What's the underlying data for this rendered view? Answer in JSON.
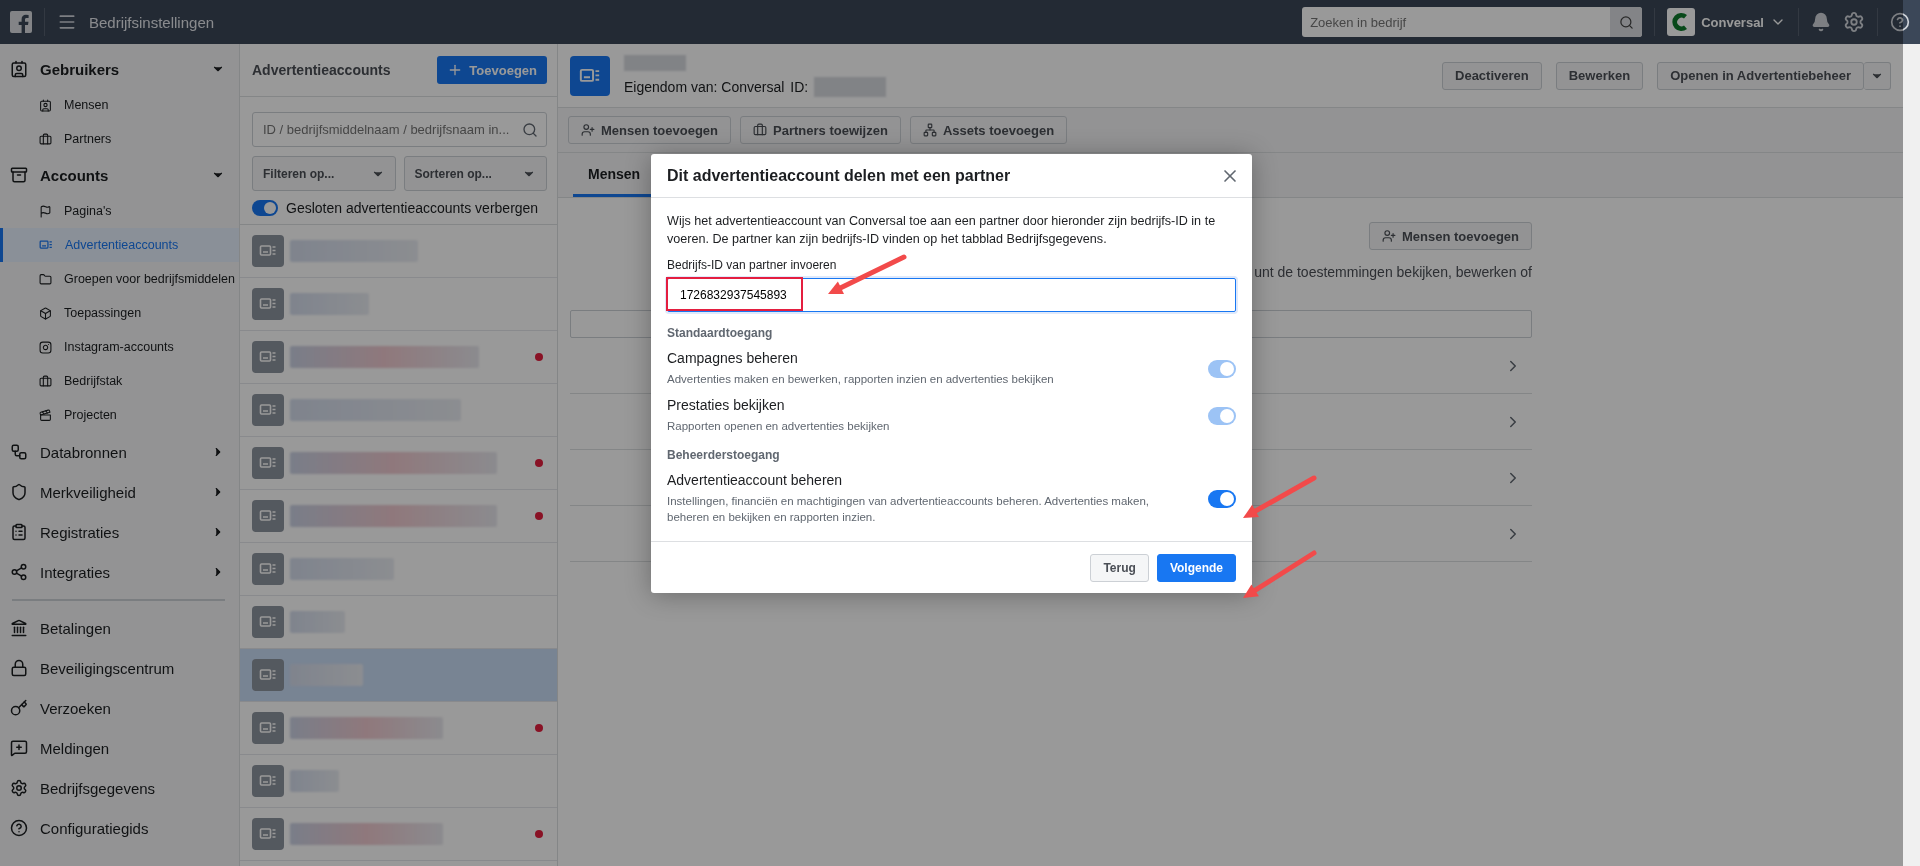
{
  "top_bar": {
    "title": "Bedrijfsinstellingen",
    "search": {
      "placeholder": "Zoeken in bedrijf"
    },
    "business": "Conversal"
  },
  "sidebar": {
    "sections": [
      {
        "label": "Gebruikers",
        "expanded": true,
        "children": [
          {
            "label": "Mensen",
            "selected": false
          },
          {
            "label": "Partners",
            "selected": false
          }
        ]
      },
      {
        "label": "Accounts",
        "expanded": true,
        "children": [
          {
            "label": "Pagina's",
            "selected": false
          },
          {
            "label": "Advertentieaccounts",
            "selected": true
          },
          {
            "label": "Groepen voor bedrijfsmiddelen",
            "selected": false
          },
          {
            "label": "Toepassingen",
            "selected": false
          },
          {
            "label": "Instagram-accounts",
            "selected": false
          },
          {
            "label": "Bedrijfstak",
            "selected": false
          },
          {
            "label": "Projecten",
            "selected": false
          }
        ]
      },
      {
        "label": "Databronnen",
        "expanded": false
      },
      {
        "label": "Merkveiligheid",
        "expanded": false
      },
      {
        "label": "Registraties",
        "expanded": false
      },
      {
        "label": "Integraties",
        "expanded": false
      }
    ],
    "links": [
      {
        "label": "Betalingen"
      },
      {
        "label": "Beveiligingscentrum"
      },
      {
        "label": "Verzoeken"
      },
      {
        "label": "Meldingen"
      },
      {
        "label": "Bedrijfsgegevens"
      },
      {
        "label": "Configuratiegids"
      }
    ]
  },
  "account_list": {
    "title": "Advertentieaccounts",
    "add_button": "Toevoegen",
    "search": {
      "placeholder": "ID / bedrijfsmiddelnaam / bedrijfsnaam in..."
    },
    "filters": [
      "Filteren op...",
      "Sorteren op..."
    ],
    "hide_closed": {
      "label": "Gesloten advertentieaccounts verbergen",
      "on": true
    },
    "rows": [
      {
        "selected": false,
        "alert": false
      },
      {
        "selected": false,
        "alert": false
      },
      {
        "selected": false,
        "alert": true
      },
      {
        "selected": false,
        "alert": false
      },
      {
        "selected": false,
        "alert": true
      },
      {
        "selected": false,
        "alert": true
      },
      {
        "selected": false,
        "alert": false
      },
      {
        "selected": false,
        "alert": false
      },
      {
        "selected": true,
        "alert": false
      },
      {
        "selected": false,
        "alert": true
      },
      {
        "selected": false,
        "alert": false
      },
      {
        "selected": false,
        "alert": true
      }
    ]
  },
  "account": {
    "owner": "Eigendom van: Conversal",
    "id_label": "ID:",
    "actions": [
      "Deactiveren",
      "Bewerken",
      "Openen in Advertentiebeheer"
    ],
    "tools": [
      "Mensen toevoegen",
      "Partners toewijzen",
      "Assets toevoegen"
    ],
    "tabs": [
      {
        "label": "Mensen",
        "selected": true
      }
    ],
    "add_people": "Mensen toevoegen",
    "intro_fragment": "unt de toestemmingen bekijken, bewerken of"
  },
  "modal": {
    "title": "Dit advertentieaccount delen met een partner",
    "intro": "Wijs het advertentieaccount van Conversal toe aan een partner door hieronder zijn bedrijfs-ID in te voeren. De partner kan zijn bedrijfs-ID vinden op het tabblad Bedrijfsgegevens.",
    "id_field": {
      "label": "Bedrijfs-ID van partner invoeren",
      "value": "1726832937545893"
    },
    "sections": [
      {
        "heading": "Standaardtoegang",
        "permissions": [
          {
            "name": "Campagnes beheren",
            "description": "Advertenties maken en bewerken, rapporten inzien en advertenties bekijken",
            "on": true,
            "disabled": true
          },
          {
            "name": "Prestaties bekijken",
            "description": "Rapporten openen en advertenties bekijken",
            "on": true,
            "disabled": true
          }
        ]
      },
      {
        "heading": "Beheerderstoegang",
        "permissions": [
          {
            "name": "Advertentieaccount beheren",
            "description": "Instellingen, financiën en machtigingen van advertentieaccounts beheren. Advertenties maken, beheren en bekijken en rapporten inzien.",
            "on": true,
            "disabled": false
          }
        ]
      }
    ],
    "buttons": [
      {
        "label": "Terug",
        "kind": "secondary"
      },
      {
        "label": "Volgende",
        "kind": "primary"
      }
    ]
  }
}
